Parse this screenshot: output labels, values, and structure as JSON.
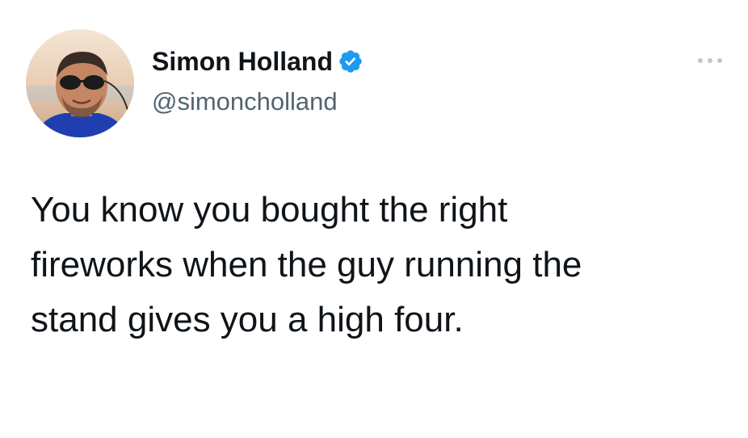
{
  "tweet": {
    "author": {
      "display_name": "Simon Holland",
      "handle": "@simoncholland",
      "verified": true,
      "verified_icon": "verified-badge-icon",
      "avatar_icon": "profile-photo"
    },
    "text_lines": [
      "You know you bought the right",
      "fireworks when the guy running the",
      "stand gives you a high four."
    ],
    "more_icon": "more-options-icon"
  },
  "colors": {
    "text": "#0f1419",
    "secondary_text": "#536471",
    "verified_blue": "#1d9bf0",
    "background": "#ffffff"
  }
}
